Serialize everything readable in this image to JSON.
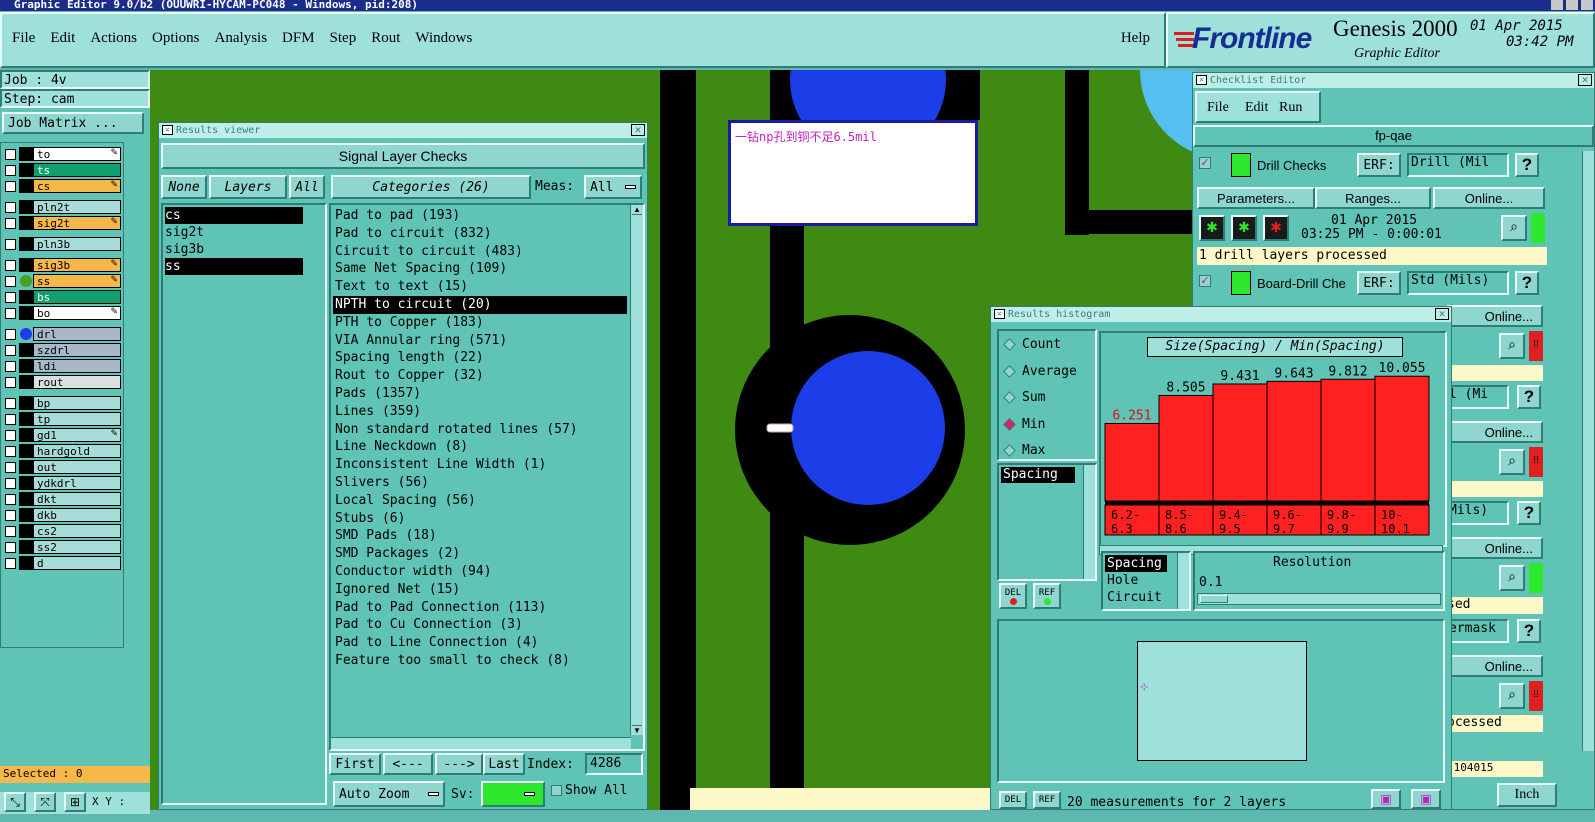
{
  "window": {
    "title": "Graphic Editor 9.0/b2 (OUUWRI-HYCAM-PC048 - Windows, pid:208)"
  },
  "menu": {
    "items": [
      "File",
      "Edit",
      "Actions",
      "Options",
      "Analysis",
      "DFM",
      "Step",
      "Rout",
      "Windows"
    ],
    "help": "Help"
  },
  "brand": {
    "logo": "Frontline",
    "product": "Genesis 2000",
    "subtitle": "Graphic Editor",
    "date": "01 Apr 2015",
    "time": "03:42 PM"
  },
  "job": {
    "job": "Job : 4v",
    "step": "Step: cam",
    "matrix_button": "Job Matrix ...",
    "selected": "Selected : 0",
    "xy_label": "X Y :"
  },
  "layers": [
    {
      "name": "to",
      "color": "#ffffff",
      "edit": true
    },
    {
      "name": "ts",
      "color": "#10a070",
      "edit": false
    },
    {
      "name": "cs",
      "color": "#f7b84a",
      "edit": true
    },
    {
      "name": "pln2t",
      "color": "#a8dcd8",
      "edit": false
    },
    {
      "name": "sig2t",
      "color": "#f7b84a",
      "edit": true
    },
    {
      "name": "pln3b",
      "color": "#a8dcd8",
      "edit": false
    },
    {
      "name": "sig3b",
      "color": "#f7b84a",
      "edit": true
    },
    {
      "name": "ss",
      "color": "#f7b84a",
      "edit": true
    },
    {
      "name": "bs",
      "color": "#10a070",
      "edit": false
    },
    {
      "name": "bo",
      "color": "#ffffff",
      "edit": true
    },
    {
      "name": "drl",
      "color": "#a8b8c8",
      "edit": false
    },
    {
      "name": "szdrl",
      "color": "#a8b8c8",
      "edit": false
    },
    {
      "name": "ldi",
      "color": "#a8b8c8",
      "edit": false
    },
    {
      "name": "rout",
      "color": "#d8e0e0",
      "edit": false
    },
    {
      "name": "bp",
      "color": "#a8dcd8",
      "edit": false
    },
    {
      "name": "tp",
      "color": "#a8dcd8",
      "edit": false
    },
    {
      "name": "gd1",
      "color": "#a8dcd8",
      "edit": true
    },
    {
      "name": "hardgold",
      "color": "#a8dcd8",
      "edit": false
    },
    {
      "name": "out",
      "color": "#a8dcd8",
      "edit": false
    },
    {
      "name": "ydkdrl",
      "color": "#a8dcd8",
      "edit": false
    },
    {
      "name": "dkt",
      "color": "#a8dcd8",
      "edit": false
    },
    {
      "name": "dkb",
      "color": "#a8dcd8",
      "edit": false
    },
    {
      "name": "cs2",
      "color": "#a8dcd8",
      "edit": false
    },
    {
      "name": "ss2",
      "color": "#a8dcd8",
      "edit": false
    },
    {
      "name": "d",
      "color": "#a8dcd8",
      "edit": false
    }
  ],
  "results_viewer": {
    "title": "Results viewer",
    "header": "Signal Layer Checks",
    "none_btn": "None",
    "layers_btn": "Layers",
    "all_btn": "All",
    "categories_btn": "Categories (26)",
    "meas_label": "Meas:",
    "meas_value": "All",
    "layer_list": [
      "cs",
      "sig2t",
      "sig3b",
      "ss"
    ],
    "categories": [
      "Pad to pad (193)",
      "Pad to circuit (832)",
      "Circuit to circuit (483)",
      "Same Net Spacing (109)",
      "Text to text (15)",
      "NPTH to circuit (20)",
      "PTH to Copper (183)",
      "VIA Annular ring (571)",
      "Spacing length (22)",
      "Rout to Copper (32)",
      "Pads (1357)",
      "Lines (359)",
      "Non standard rotated lines (57)",
      "Line Neckdown (8)",
      "Inconsistent Line Width (1)",
      "Slivers (56)",
      "Local Spacing (56)",
      "Stubs (6)",
      "SMD Pads (18)",
      "SMD Packages (2)",
      "Conductor width (94)",
      "Ignored Net (15)",
      "Pad to Pad Connection (113)",
      "Pad to Cu Connection (3)",
      "Pad to Line Connection (4)",
      "Feature too small to check (8)"
    ],
    "nav": {
      "first": "First",
      "prev": "<---",
      "next": "--->",
      "last": "Last",
      "index_label": "Index:",
      "index_value": "4286"
    },
    "auto_zoom": "Auto Zoom",
    "sv_label": "Sv:",
    "show_all": "Show All"
  },
  "annotation": "一钻np孔到铜不足6.5mil",
  "checklist": {
    "title": "Checklist Editor",
    "menu": [
      "File",
      "Edit",
      "Run"
    ],
    "name": "fp-qae",
    "drill_checks": "Drill Checks",
    "erf_label": "ERF:",
    "erf_drill": "Drill (Mil",
    "help": "?",
    "parameters": "Parameters...",
    "ranges": "Ranges...",
    "online": "Online...",
    "run_date": "01 Apr 2015",
    "run_time": "03:25 PM - 0:00:01",
    "status_drill": "1 drill layers processed",
    "board_drill": "Board-Drill Che",
    "erf_std": "Std (Mils)",
    "partial": [
      "l (Mi",
      "Mils)",
      "sed",
      "ermask",
      "ocessed",
      ".104015"
    ],
    "units": "Inch"
  },
  "histogram": {
    "title": "Results histogram",
    "modes": [
      "Count",
      "Average",
      "Sum",
      "Min",
      "Max"
    ],
    "selected_mode": "Min",
    "list_value": "Spacing",
    "chart_title": "Size(Spacing) / Min(Spacing)",
    "del": "DEL",
    "ref": "REF",
    "kinds": [
      "Spacing",
      "Hole",
      "Circuit"
    ],
    "resolution_label": "Resolution",
    "resolution_value": "0.1",
    "footer": "20 measurements for 2 layers"
  },
  "chart_data": {
    "type": "bar",
    "title": "Size(Spacing) / Min(Spacing)",
    "categories": [
      "6.2-6.3",
      "8.5-8.6",
      "9.4-9.5",
      "9.6-9.7",
      "9.8-9.9",
      "10-10.1"
    ],
    "category_labels": [
      [
        "6.2-",
        "6.3"
      ],
      [
        "8.5-",
        "8.6"
      ],
      [
        "9.4-",
        "9.5"
      ],
      [
        "9.6-",
        "9.7"
      ],
      [
        "9.8-",
        "9.9"
      ],
      [
        "10-",
        "10.1"
      ]
    ],
    "values": [
      6.251,
      8.505,
      9.431,
      9.643,
      9.812,
      10.055
    ],
    "ylim": [
      0,
      10.8
    ],
    "bar_color": "#ff2020",
    "first_label_color": "#e01010"
  }
}
